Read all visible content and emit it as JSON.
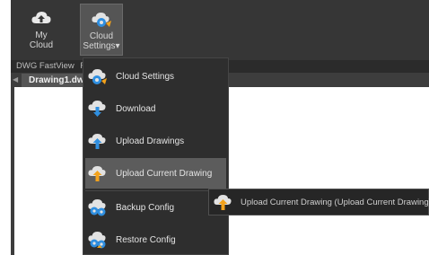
{
  "ribbon": {
    "buttons": [
      {
        "label_line1": "My",
        "label_line2": "Cloud",
        "icon": "cloud-upload-icon"
      },
      {
        "label_line1": "Cloud",
        "label_line2": "Settings",
        "dropdown": "▾",
        "icon": "cloud-settings-icon"
      }
    ],
    "group_label": "DWG FastView",
    "group_label_next": "F"
  },
  "tab": {
    "title": "Drawing1.dw"
  },
  "menu": {
    "items": [
      {
        "label": "Cloud Settings",
        "icon": "cloud-gear-icon"
      },
      {
        "label": "Download",
        "icon": "cloud-download-icon"
      },
      {
        "label": "Upload Drawings",
        "icon": "cloud-upload-drawings-icon"
      },
      {
        "label": "Upload Current Drawing",
        "icon": "cloud-upload-current-icon"
      },
      {
        "label": "Backup Config",
        "icon": "backup-config-icon"
      },
      {
        "label": "Restore Config",
        "icon": "restore-config-icon"
      }
    ]
  },
  "tooltip": {
    "text": "Upload Current Drawing (Upload Current Drawing)",
    "icon": "cloud-upload-current-icon"
  },
  "colors": {
    "ribbon_bg": "#363636",
    "menu_bg": "#2e2e2e",
    "hover_bg": "#5c5c5c",
    "cloud_blue": "#2f8fe0",
    "arrow_orange": "#f3a21b"
  }
}
